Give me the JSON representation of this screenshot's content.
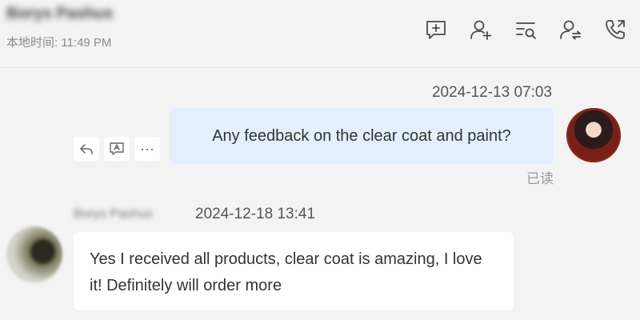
{
  "header": {
    "contact_name": "Borys Pashus",
    "local_time": "本地时间: 11:49 PM",
    "actions": [
      {
        "name": "add-comment-icon"
      },
      {
        "name": "add-contact-icon"
      },
      {
        "name": "search-messages-icon"
      },
      {
        "name": "transfer-contact-icon"
      },
      {
        "name": "call-icon"
      }
    ]
  },
  "messages": [
    {
      "direction": "outgoing",
      "time": "2024-12-13 07:03",
      "text": "Any feedback on the clear coat and paint?",
      "status": "已读",
      "actions": [
        {
          "name": "reply-icon"
        },
        {
          "name": "translate-icon"
        },
        {
          "name": "more-icon",
          "label": "···"
        }
      ]
    },
    {
      "direction": "incoming",
      "sender": "Borys Pashus",
      "time": "2024-12-18 13:41",
      "text": "Yes I received all products, clear coat is amazing, I love it! Definitely will order more"
    }
  ],
  "colors": {
    "background": "#f3f3f3",
    "outgoing_bubble": "#e3efff",
    "incoming_bubble": "#ffffff",
    "icon": "#4a4a4a"
  }
}
